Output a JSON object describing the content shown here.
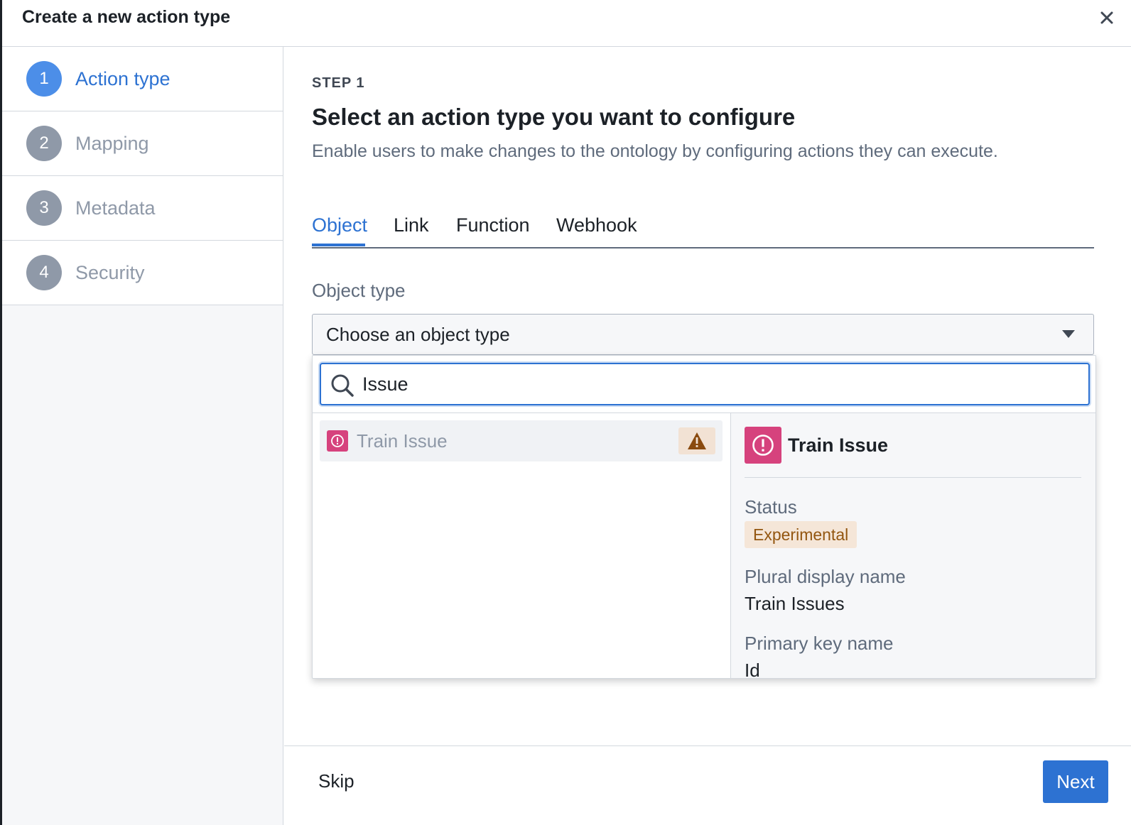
{
  "dialog": {
    "title": "Create a new action type",
    "close_icon": "close-icon"
  },
  "sidebar": {
    "steps": [
      {
        "number": "1",
        "label": "Action type",
        "active": true
      },
      {
        "number": "2",
        "label": "Mapping",
        "active": false
      },
      {
        "number": "3",
        "label": "Metadata",
        "active": false
      },
      {
        "number": "4",
        "label": "Security",
        "active": false
      }
    ]
  },
  "main": {
    "kicker": "STEP 1",
    "title": "Select an action type you want to configure",
    "description": "Enable users to make changes to the ontology by configuring actions they can execute.",
    "tabs": [
      {
        "label": "Object",
        "active": true
      },
      {
        "label": "Link",
        "active": false
      },
      {
        "label": "Function",
        "active": false
      },
      {
        "label": "Webhook",
        "active": false
      }
    ],
    "object_type": {
      "label": "Object type",
      "placeholder": "Choose an object type"
    }
  },
  "popover": {
    "search": {
      "value": "Issue",
      "icon": "search-icon"
    },
    "results": [
      {
        "label": "Train Issue",
        "icon": "issue-icon",
        "warning_icon": "warning-icon"
      }
    ],
    "detail": {
      "title": "Train Issue",
      "icon": "issue-icon",
      "status_label": "Status",
      "status_value": "Experimental",
      "plural_label": "Plural display name",
      "plural_value": "Train Issues",
      "primary_key_label": "Primary key name",
      "primary_key_value": "Id"
    }
  },
  "footer": {
    "skip_label": "Skip",
    "next_label": "Next"
  },
  "colors": {
    "accent": "#2d72d2",
    "object_icon": "#d6427d",
    "status_tag_bg": "#f5e6d8",
    "status_tag_text": "#935610"
  }
}
